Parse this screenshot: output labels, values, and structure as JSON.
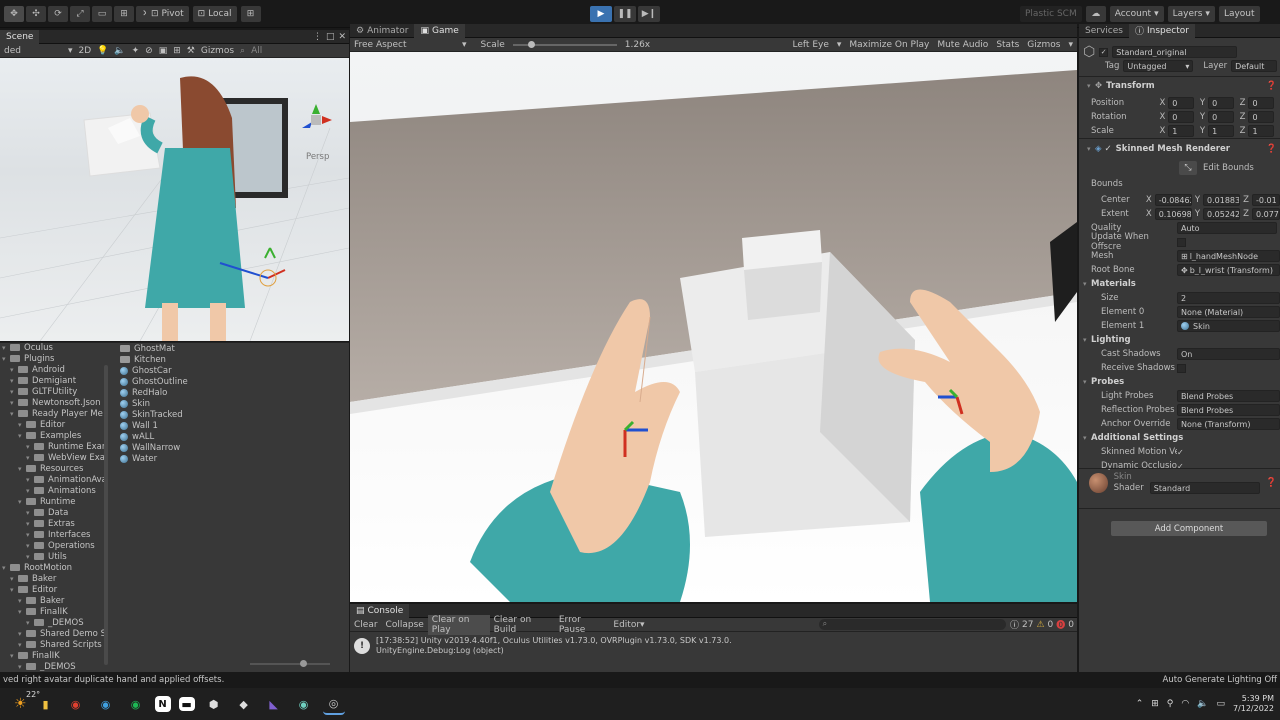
{
  "toolbar": {
    "pivot": "Pivot",
    "local": "Local",
    "plastic": "Plastic SCM",
    "account": "Account",
    "layers": "Layers",
    "layout": "Layout"
  },
  "scene": {
    "tab": "Scene",
    "mode": "ded",
    "two_d": "2D",
    "gizmos": "Gizmos",
    "all": "All",
    "persp": "Persp"
  },
  "game": {
    "tabs": [
      "Animator",
      "Game"
    ],
    "aspect": "Free Aspect",
    "scale_label": "Scale",
    "scale_value": "1.26x",
    "scale_fraction": 0.15,
    "left_eye": "Left Eye",
    "maximize": "Maximize On Play",
    "mute": "Mute Audio",
    "stats": "Stats",
    "gizmos": "Gizmos"
  },
  "project": {
    "folders": [
      {
        "label": "Oculus",
        "indent": 0
      },
      {
        "label": "Plugins",
        "indent": 0
      },
      {
        "label": "Android",
        "indent": 1
      },
      {
        "label": "Demigiant",
        "indent": 1
      },
      {
        "label": "GLTFUtility",
        "indent": 1
      },
      {
        "label": "Newtonsoft.Json",
        "indent": 1
      },
      {
        "label": "Ready Player Me",
        "indent": 1
      },
      {
        "label": "Editor",
        "indent": 2
      },
      {
        "label": "Examples",
        "indent": 2
      },
      {
        "label": "Runtime Exampl",
        "indent": 3
      },
      {
        "label": "WebView Examp",
        "indent": 3
      },
      {
        "label": "Resources",
        "indent": 2
      },
      {
        "label": "AnimationAvatar",
        "indent": 3
      },
      {
        "label": "Animations",
        "indent": 3
      },
      {
        "label": "Runtime",
        "indent": 2
      },
      {
        "label": "Data",
        "indent": 3
      },
      {
        "label": "Extras",
        "indent": 3
      },
      {
        "label": "Interfaces",
        "indent": 3
      },
      {
        "label": "Operations",
        "indent": 3
      },
      {
        "label": "Utils",
        "indent": 3
      },
      {
        "label": "RootMotion",
        "indent": 0
      },
      {
        "label": "Baker",
        "indent": 1
      },
      {
        "label": "Editor",
        "indent": 1
      },
      {
        "label": "Baker",
        "indent": 2
      },
      {
        "label": "FinalIK",
        "indent": 2
      },
      {
        "label": "_DEMOS",
        "indent": 3
      },
      {
        "label": "Shared Demo Sc",
        "indent": 2
      },
      {
        "label": "Shared Scripts",
        "indent": 2
      },
      {
        "label": "FinalIK",
        "indent": 1
      },
      {
        "label": "_DEMOS",
        "indent": 2
      }
    ],
    "assets": [
      "GhostMat",
      "Kitchen",
      "GhostCar",
      "GhostOutline",
      "RedHalo",
      "Skin",
      "SkinTracked",
      "Wall 1",
      "wALL",
      "WallNarrow",
      "Water"
    ]
  },
  "console": {
    "tab": "Console",
    "buttons": [
      "Clear",
      "Collapse",
      "Clear on Play",
      "Clear on Build",
      "Error Pause",
      "Editor"
    ],
    "counts": [
      "27",
      "0",
      "0"
    ],
    "log_line1": "[17:38:52] Unity v2019.4.40f1, Oculus Utilities v1.73.0, OVRPlugin v1.73.0, SDK v1.73.0.",
    "log_line2": "UnityEngine.Debug:Log (object)"
  },
  "inspector": {
    "tabs": [
      "Services",
      "Inspector"
    ],
    "object_name": "Standard_original",
    "tag_label": "Tag",
    "tag_value": "Untagged",
    "layer_label": "Layer",
    "layer_value": "Default",
    "transform": {
      "title": "Transform",
      "rows": [
        {
          "label": "Position",
          "x": "0",
          "y": "0",
          "z": "0"
        },
        {
          "label": "Rotation",
          "x": "0",
          "y": "0",
          "z": "0"
        },
        {
          "label": "Scale",
          "x": "1",
          "y": "1",
          "z": "1"
        }
      ]
    },
    "smr": {
      "title": "Skinned Mesh Renderer",
      "edit_bounds": "Edit Bounds",
      "bounds": "Bounds",
      "center_label": "Center",
      "center": {
        "x": "-0.08462",
        "y": "0.018837",
        "z": "-0.01"
      },
      "extent_label": "Extent",
      "extent": {
        "x": "0.106983",
        "y": "0.052427",
        "z": "0.077"
      },
      "quality_label": "Quality",
      "quality": "Auto",
      "update_label": "Update When Offscre",
      "mesh_label": "Mesh",
      "mesh": "l_handMeshNode",
      "root_label": "Root Bone",
      "root": "b_l_wrist (Transform)",
      "materials": "Materials",
      "size_label": "Size",
      "size": "2",
      "el0_label": "Element 0",
      "el0": "None (Material)",
      "el1_label": "Element 1",
      "el1": "Skin",
      "lighting": "Lighting",
      "cast_label": "Cast Shadows",
      "cast": "On",
      "receive_label": "Receive Shadows",
      "probes": "Probes",
      "light_probes_label": "Light Probes",
      "light_probes": "Blend Probes",
      "refl_label": "Reflection Probes",
      "refl": "Blend Probes",
      "anchor_label": "Anchor Override",
      "anchor": "None (Transform)",
      "additional": "Additional Settings",
      "skinned_motion": "Skinned Motion Ve",
      "dynamic_occ": "Dynamic Occlusio"
    },
    "material": {
      "name": "Skin",
      "shader_label": "Shader",
      "shader": "Standard"
    },
    "add_component": "Add Component"
  },
  "statusbar": {
    "message": "ved right avatar duplicate hand and applied offsets.",
    "right": "Auto Generate Lighting Off"
  },
  "taskbar": {
    "time": "5:39 PM",
    "date": "7/12/2022",
    "weather": "22°"
  },
  "colors": {
    "accent_blue": "#3a72b0",
    "editor_bg": "#383838",
    "sleeve_teal": "#3fa8a8",
    "skin": "#f0c8a8"
  }
}
